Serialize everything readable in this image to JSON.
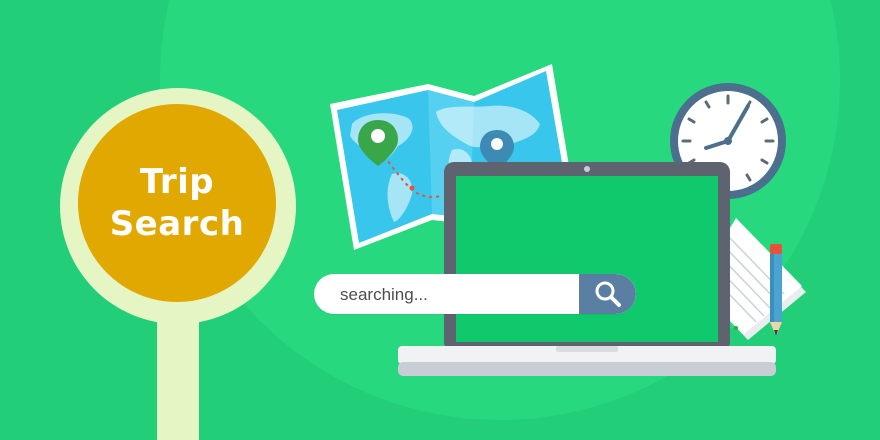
{
  "sign": {
    "line1": "Trip",
    "line2": "Search"
  },
  "search": {
    "value": "searching..."
  },
  "icons": {
    "search": "magnifier-icon",
    "map": "world-map-icon",
    "clock": "clock-icon",
    "laptop": "laptop-icon",
    "notepad": "notepad-icon",
    "pencil": "pencil-icon",
    "pin_green": "location-pin-icon",
    "pin_blue": "location-pin-icon"
  },
  "colors": {
    "background": "#22cf78",
    "sign_face": "#e0a800",
    "sign_ring": "#e6f5c4",
    "laptop_screen": "#10c96c",
    "search_button": "#5a7fa3"
  }
}
